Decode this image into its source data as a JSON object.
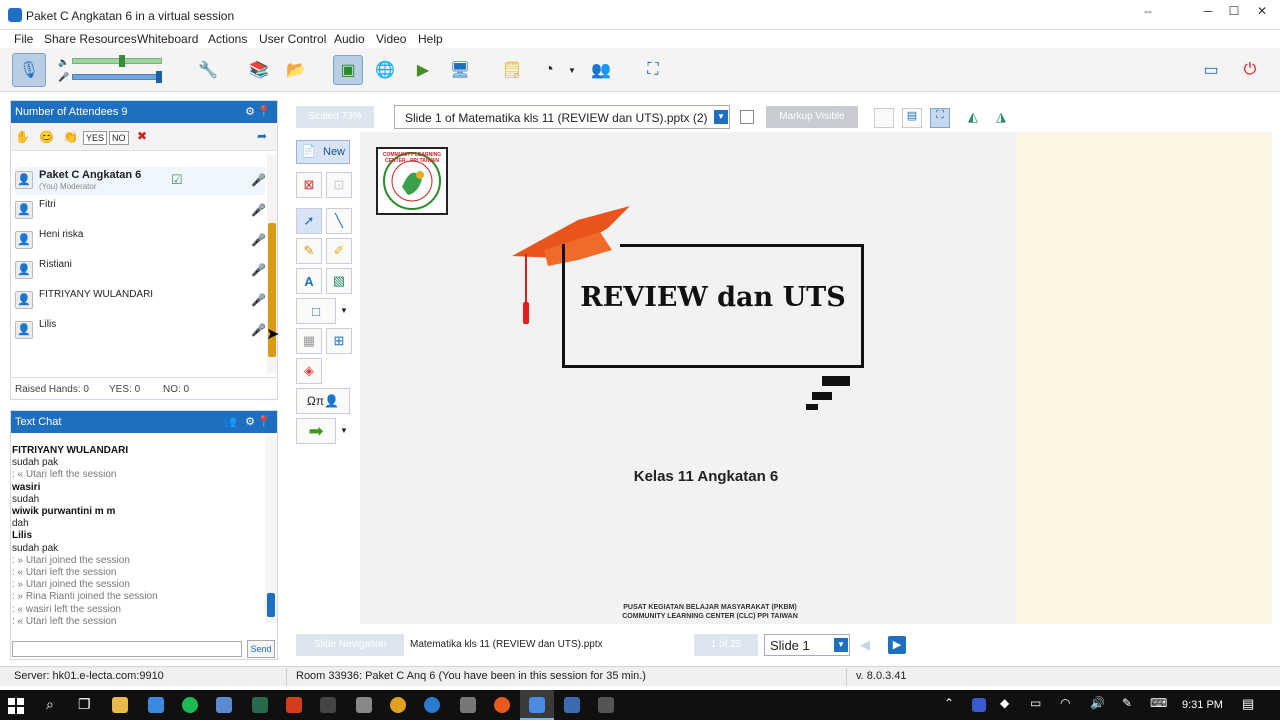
{
  "window": {
    "title": "Paket C Angkatan 6 in a virtual session"
  },
  "menu": [
    "File",
    "Share Resources",
    "Whiteboard",
    "Actions",
    "User Control",
    "Audio",
    "Video",
    "Help"
  ],
  "attendees": {
    "header": "Number of Attendees 9",
    "status_buttons": [
      "YES",
      "NO"
    ],
    "list": [
      {
        "name": "Paket C Angkatan 6",
        "role": "(You) Moderator"
      },
      {
        "name": "Fitri"
      },
      {
        "name": "Heni riska"
      },
      {
        "name": "Ristiani"
      },
      {
        "name": "FITRIYANY WULANDARI"
      },
      {
        "name": "Lilis"
      }
    ],
    "raised_hands": "Raised Hands: 0",
    "yes": "YES: 0",
    "no": "NO: 0"
  },
  "chat": {
    "header": "Text Chat",
    "send_label": "Send",
    "input_value": "",
    "lines": [
      {
        "t": "FITRIYANY WULANDARI",
        "c": "b"
      },
      {
        "t": "sudah pak",
        "c": ""
      },
      {
        "t": ": « Utari left the session",
        "c": "s"
      },
      {
        "t": "wasiri",
        "c": "b"
      },
      {
        "t": "sudah",
        "c": ""
      },
      {
        "t": "wiwik purwantini m m",
        "c": "b"
      },
      {
        "t": "dah",
        "c": ""
      },
      {
        "t": "Lilis",
        "c": "b"
      },
      {
        "t": "sudah pak",
        "c": ""
      },
      {
        "t": ": » Utari joined the session",
        "c": "s"
      },
      {
        "t": ": « Utari left the session",
        "c": "s"
      },
      {
        "t": ": » Utari joined the session",
        "c": "s"
      },
      {
        "t": ": » Rina Rianti joined the session",
        "c": "s"
      },
      {
        "t": ": « wasiri left the session",
        "c": "s"
      },
      {
        "t": ": « Utari left the session",
        "c": "s"
      }
    ]
  },
  "whiteboard": {
    "scaled": "Scaled 73%",
    "slide_select": "Slide 1 of Matematika kls 11 (REVIEW dan UTS).pptx (2)",
    "markup": "Markup Visible",
    "new_label": "New",
    "math_label": "Ωπ"
  },
  "slide": {
    "logo_text": "COMMUNITY LEARNING CENTER · PPI TAIWAN",
    "title": "REVIEW dan UTS",
    "subtitle": "Kelas 11 Angkatan 6",
    "footer1": "PUSAT KEGIATAN BELAJAR MASYARAKAT (PKBM)",
    "footer2": "COMMUNITY LEARNING CENTER (CLC) PPI TAIWAN"
  },
  "nav": {
    "label": "Slide Navigation",
    "file": "Matematika kls 11 (REVIEW dan UTS).pptx",
    "page": "1 of 25",
    "slide": "Slide 1"
  },
  "status": {
    "server": "Server: hk01.e-lecta.com:9910",
    "room": "Room 33936: Paket C Anq 6 (You have been in this session for 35 min.)",
    "version": "v. 8.0.3.41"
  },
  "taskbar": {
    "time": "9:31 PM"
  }
}
